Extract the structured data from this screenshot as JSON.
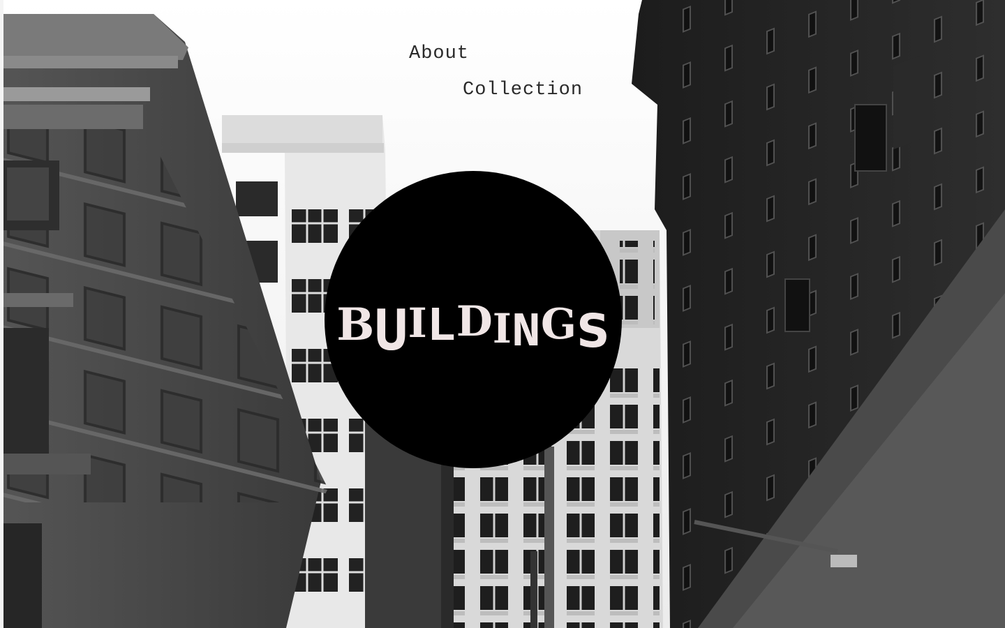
{
  "nav": {
    "about_label": "About",
    "collection_label": "Collection"
  },
  "logo": {
    "letters": [
      "B",
      "U",
      "I",
      "L",
      "D",
      "I",
      "N",
      "G",
      "S"
    ]
  },
  "colors": {
    "background": "#f4f4f4",
    "circle": "#000000",
    "logo_text": "#f0e6e6",
    "nav_text": "#2a2a2a"
  },
  "background_image": {
    "description_icon": "city-buildings-photo"
  }
}
